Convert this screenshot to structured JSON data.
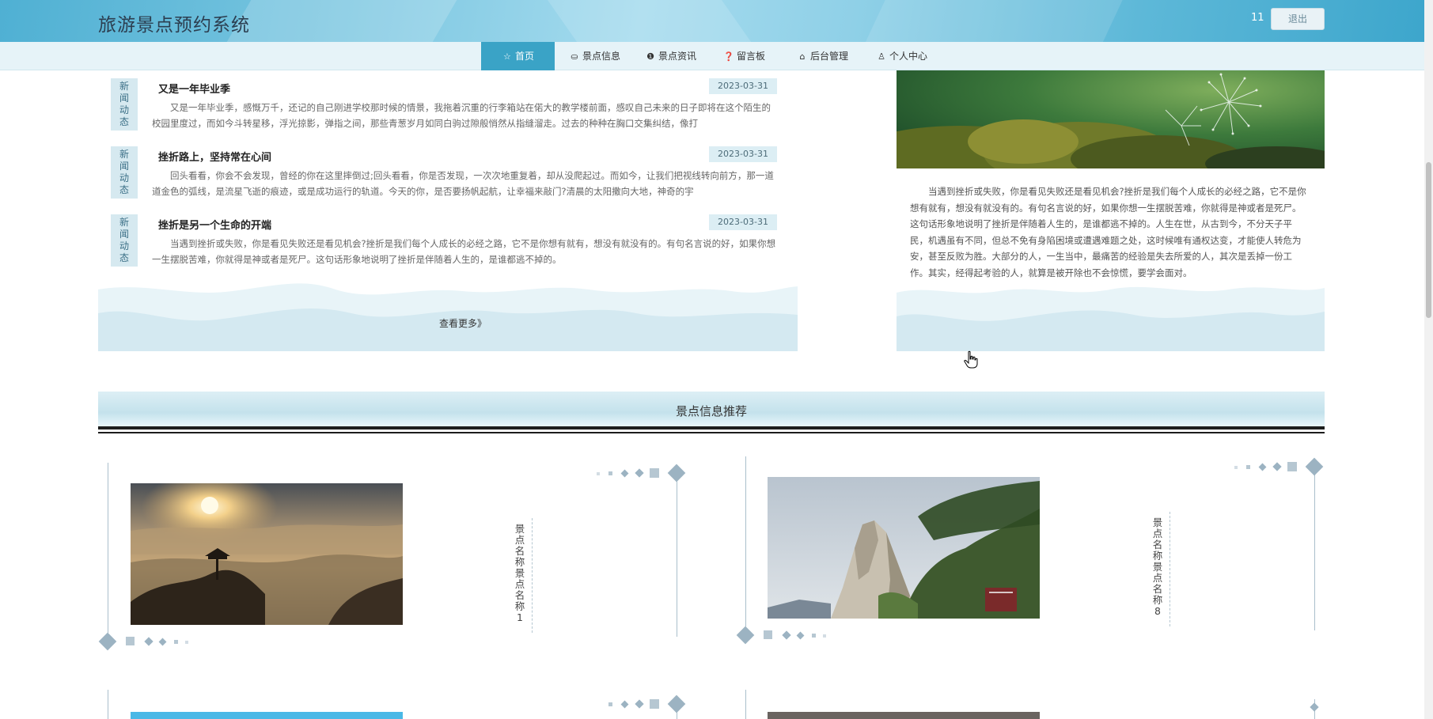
{
  "header": {
    "site_title": "旅游景点预约系统",
    "user_name": "11",
    "logout_label": "退出"
  },
  "nav": {
    "items": [
      {
        "label": "首页",
        "icon": "star-icon",
        "active": true
      },
      {
        "label": "景点信息",
        "icon": "bag-icon"
      },
      {
        "label": "景点资讯",
        "icon": "info-icon"
      },
      {
        "label": "留言板",
        "icon": "question-icon"
      },
      {
        "label": "后台管理",
        "icon": "gift-icon"
      },
      {
        "label": "个人中心",
        "icon": "user-icon"
      }
    ]
  },
  "news": {
    "tag": "新闻动态",
    "items": [
      {
        "title": "又是一年毕业季",
        "date": "2023-03-31",
        "body": "又是一年毕业季，感慨万千，还记的自己刚进学校那时候的情景，我拖着沉重的行李箱站在偌大的教学楼前面，感叹自己未来的日子即将在这个陌生的校园里度过，而如今斗转星移，浮光掠影，弹指之间，那些青葱岁月如同白驹过隙般悄然从指缝溜走。过去的种种在胸口交集纠结，像打"
      },
      {
        "title": "挫折路上，坚持常在心间",
        "date": "2023-03-31",
        "body": "回头看看，你会不会发现，曾经的你在这里摔倒过;回头看看，你是否发现，一次次地重复着，却从没爬起过。而如今，让我们把视线转向前方，那一道道金色的弧线，是流星飞逝的痕迹，或是成功运行的轨道。今天的你，是否要扬帆起航，让幸福来敲门?清晨的太阳撒向大地，神奇的宇"
      },
      {
        "title": "挫折是另一个生命的开端",
        "date": "2023-03-31",
        "body": "当遇到挫折或失败，你是看见失败还是看见机会?挫折是我们每个人成长的必经之路，它不是你想有就有，想没有就没有的。有句名言说的好，如果你想一生摆脱苦难，你就得是神或者是死尸。这句话形象地说明了挫折是伴随着人生的，是谁都逃不掉的。"
      }
    ],
    "more_label": "查看更多》"
  },
  "feature": {
    "text": "当遇到挫折或失败，你是看见失败还是看见机会?挫折是我们每个人成长的必经之路，它不是你想有就有，想没有就没有的。有句名言说的好，如果你想一生摆脱苦难，你就得是神或者是死尸。这句话形象地说明了挫折是伴随着人生的，是谁都逃不掉的。人生在世，从古到今，不分天子平民，机遇虽有不同，但总不免有身陷困境或遭遇难题之处，这时候唯有通权达变，才能使人转危为安，甚至反败为胜。大部分的人，一生当中，最痛苦的经验是失去所爱的人，其次是丢掉一份工作。其实，经得起考验的人，就算是被开除也不会惊慌，要学会面对。"
  },
  "recommend": {
    "title": "景点信息推荐",
    "cards": [
      {
        "name": "景点名称景点名称1"
      },
      {
        "name": "景点名称景点名称8"
      }
    ]
  },
  "colors": {
    "accent": "#3aa3c6",
    "nav_bg": "#e6f3f8",
    "wave": "#d4e9f1"
  }
}
